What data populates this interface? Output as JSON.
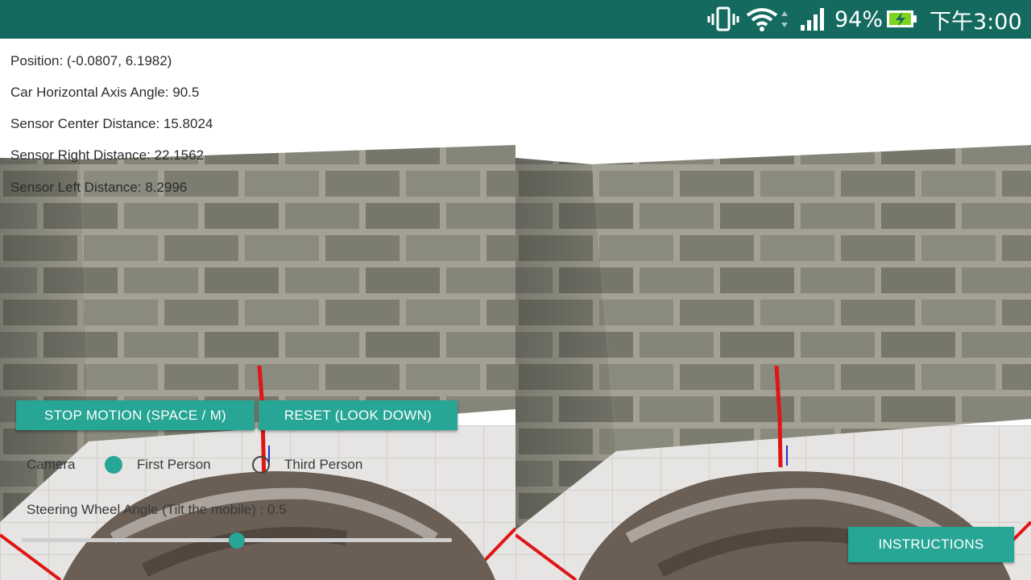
{
  "status_bar": {
    "battery_percent": "94%",
    "time": "下午3:00",
    "background_color": "#156a5f",
    "icons": [
      "vibrate-icon",
      "wifi-icon",
      "signal-icon",
      "battery-charging-icon"
    ]
  },
  "telemetry": {
    "position": "Position: (-0.0807, 6.1982)",
    "car_axis_angle": "Car Horizontal Axis Angle: 90.5",
    "sensor_center": "Sensor Center Distance: 15.8024",
    "sensor_right": "Sensor Right Distance: 22.1562",
    "sensor_left": "Sensor Left Distance: 8.2996"
  },
  "controls": {
    "stop_motion_label": "STOP MOTION (SPACE / M)",
    "reset_label": "RESET (LOOK DOWN)",
    "camera_label": "Camera",
    "first_person_label": "First Person",
    "third_person_label": "Third Person",
    "selected_camera": "First Person",
    "steering_label": "Steering Wheel Angle (Tilt the mobile) : 0.5",
    "steering_value_fraction": 0.5
  },
  "instructions_label": "INSTRUCTIONS",
  "colors": {
    "accent": "#27a595",
    "sensor_line": "#e01515"
  }
}
